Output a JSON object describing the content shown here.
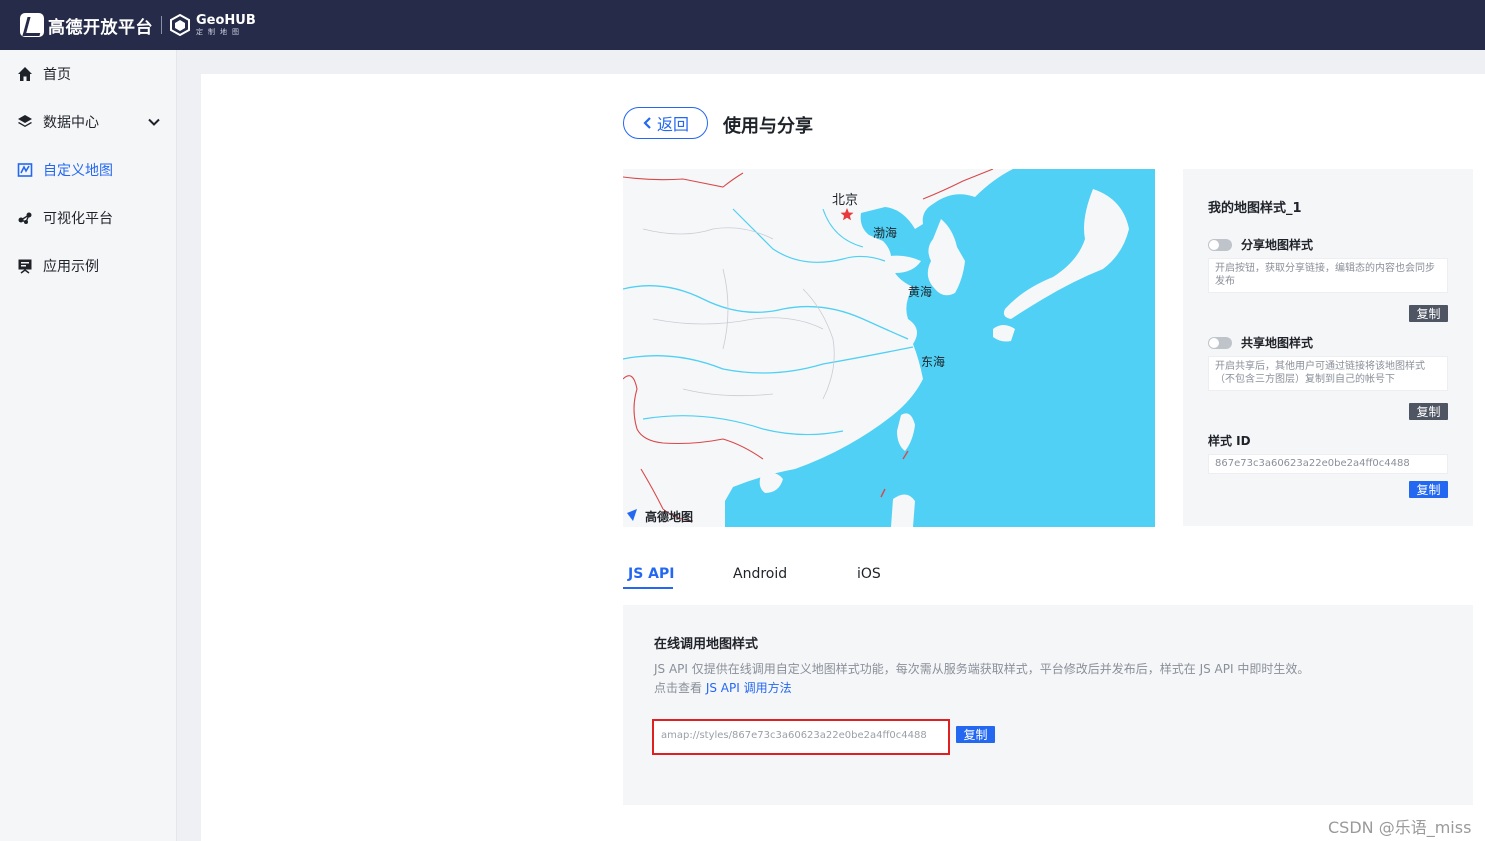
{
  "header": {
    "brand_name": "高德开放平台",
    "geohub_name": "GeoHUB",
    "geohub_sub": "定制地图"
  },
  "sidebar": {
    "items": [
      {
        "label": "首页",
        "icon": "home-icon"
      },
      {
        "label": "数据中心",
        "icon": "layers-icon"
      },
      {
        "label": "自定义地图",
        "icon": "custom-map-icon"
      },
      {
        "label": "可视化平台",
        "icon": "visualization-icon"
      },
      {
        "label": "应用示例",
        "icon": "examples-icon"
      }
    ]
  },
  "page": {
    "back_label": "返回",
    "title": "使用与分享"
  },
  "map": {
    "labels": {
      "beijing": "北京",
      "bohai": "渤海",
      "huanghai": "黄海",
      "donghai": "东海"
    },
    "logo_text": "高德地图",
    "sea_color": "#4fd0f4",
    "land_color": "#f6f7f9"
  },
  "panel": {
    "style_name": "我的地图样式_1",
    "share": {
      "label": "分享地图样式",
      "desc": "开启按钮，获取分享链接，编辑态的内容也会同步发布",
      "copy": "复制"
    },
    "public": {
      "label": "共享地图样式",
      "desc": "开启共享后，其他用户可通过链接将该地图样式（不包含三方图层）复制到自己的帐号下",
      "copy": "复制"
    },
    "style_id": {
      "label": "样式 ID",
      "value": "867e73c3a60623a22e0be2a4ff0c4488",
      "copy": "复制"
    }
  },
  "tabs": [
    "JS API",
    "Android",
    "iOS"
  ],
  "jsapi": {
    "title": "在线调用地图样式",
    "desc": "JS API 仅提供在线调用自定义地图样式功能，每次需从服务端获取样式，平台修改后并发布后，样式在 JS API 中即时生效。",
    "link_prefix": "点击查看 ",
    "link_text": "JS API 调用方法",
    "url": "amap://styles/867e73c3a60623a22e0be2a4ff0c4488",
    "copy": "复制"
  },
  "watermark": "CSDN @乐语_miss",
  "colors": {
    "accent": "#2468f2",
    "topbar": "#252b48",
    "highlight": "#e02020"
  }
}
